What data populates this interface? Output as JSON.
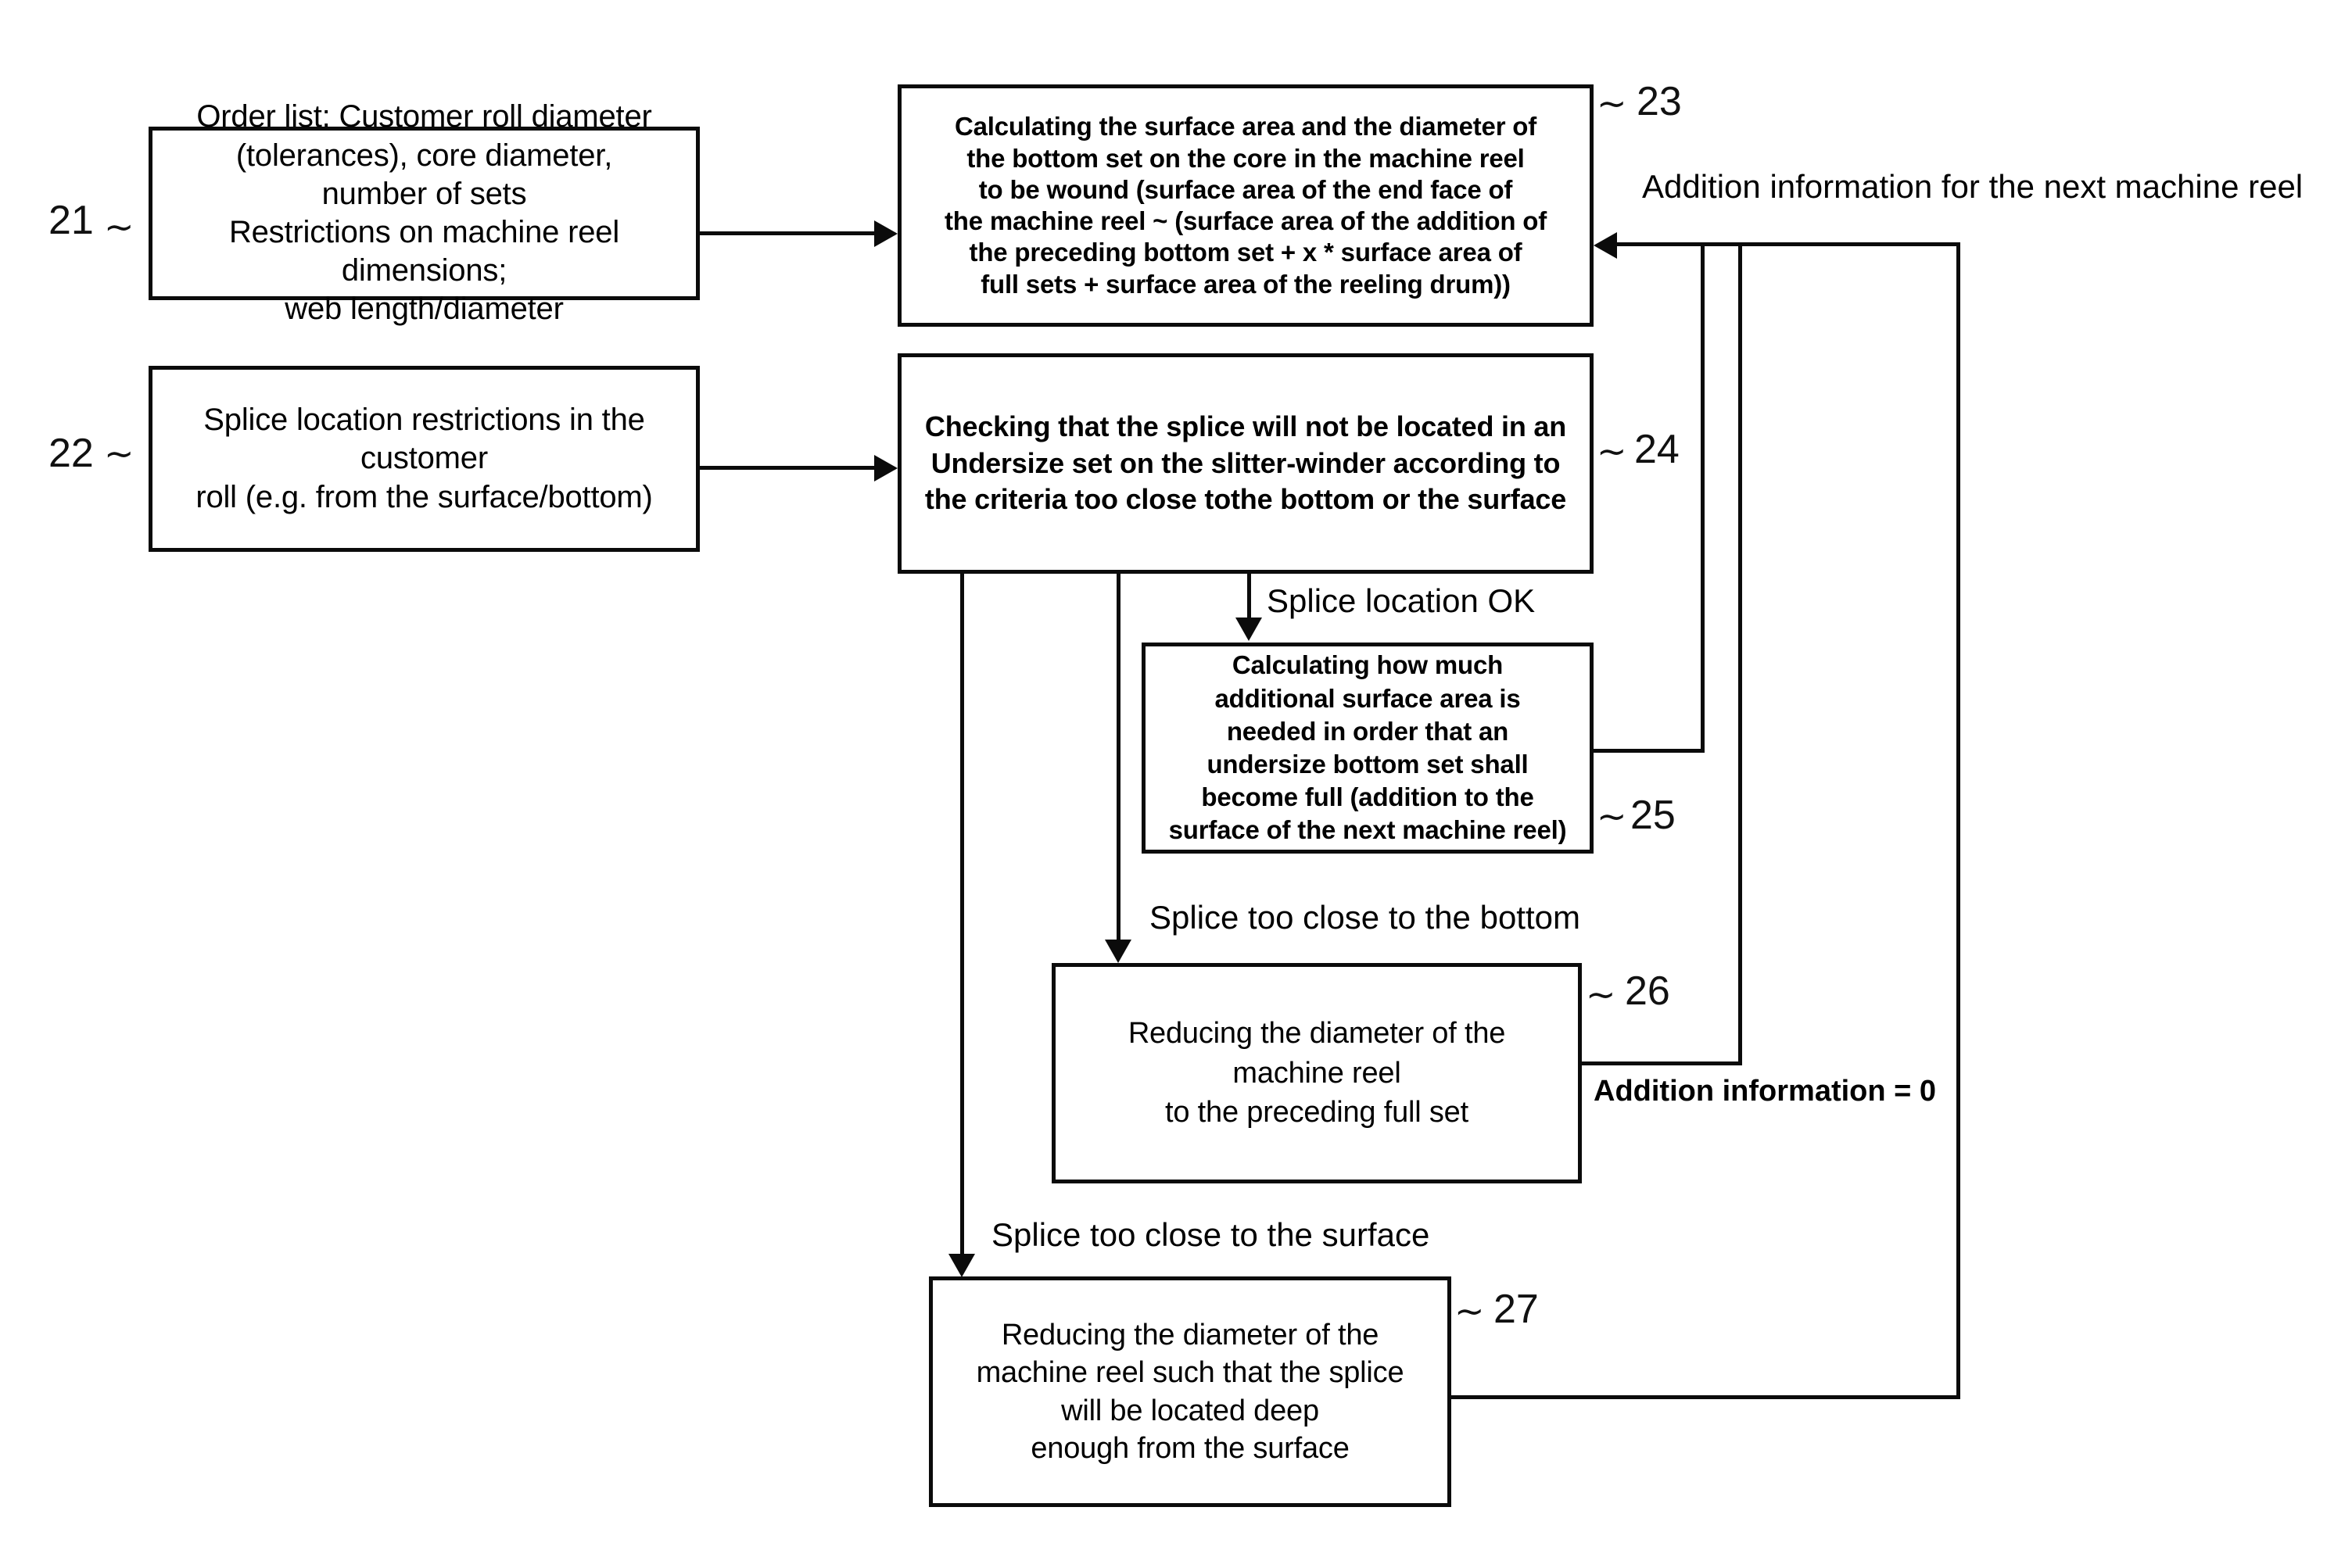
{
  "figure": {
    "type": "patent-flowchart",
    "nodes": [
      {
        "id": "21",
        "ref": "21",
        "text": "Order list: Customer roll diameter\n(tolerances), core diameter,\nnumber of sets\nRestrictions on machine reel dimensions;\nweb length/diameter"
      },
      {
        "id": "22",
        "ref": "22",
        "text": "Splice location restrictions in the customer\nroll  (e.g. from the surface/bottom)"
      },
      {
        "id": "23",
        "ref": "23",
        "text": "Calculating the surface area and the diameter of\nthe bottom set on the core in the machine reel\nto be wound (surface area of the end face of\nthe machine reel ~ (surface area of the addition of\nthe preceding bottom set + x * surface area of\nfull sets + surface area of the reeling drum))"
      },
      {
        "id": "24",
        "ref": "24",
        "text": "Checking that the splice will not be located in an\nUndersize set on the slitter-winder according to\nthe criteria too close tothe bottom or the surface"
      },
      {
        "id": "25",
        "ref": "25",
        "text": "Calculating how much\nadditional surface area is\nneeded in order that an\nundersize bottom set shall\nbecome full (addition to the\nsurface of the next machine reel)"
      },
      {
        "id": "26",
        "ref": "26",
        "text": "Reducing the diameter of the\nmachine reel\nto the preceding full set"
      },
      {
        "id": "27",
        "ref": "27",
        "text": "Reducing the diameter of the\nmachine reel such that the splice\nwill be located deep\nenough from the surface"
      }
    ],
    "edge_labels": {
      "addition_next_reel": "Addition information for the next machine reel",
      "splice_ok": "Splice location OK",
      "splice_bottom": "Splice too close to the bottom",
      "splice_surface": "Splice too close to the surface",
      "addition_zero": "Addition information = 0"
    },
    "colors": {
      "line": "#0b0b0b",
      "background": "#ffffff",
      "text": "#000000"
    }
  }
}
